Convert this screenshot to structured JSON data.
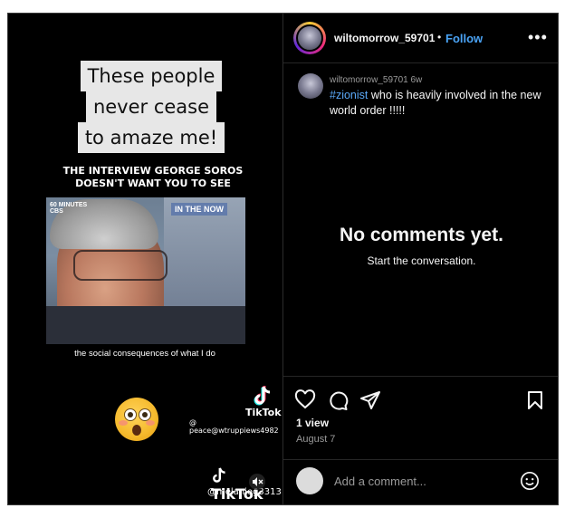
{
  "video": {
    "caption_lines": [
      "These people",
      "never cease",
      "to amaze me!"
    ],
    "subtitle_line1": "THE INTERVIEW GEORGE SOROS",
    "subtitle_line2": "DOESN'T WANT YOU TO SEE",
    "clip_logo_line1": "60 MINUTES",
    "clip_logo_line2": "CBS",
    "clip_badge": "IN THE NOW",
    "clip_subs": "the social consequences of what I do",
    "tiktok_label": "TikTok",
    "tiktok_handle_1": "@ peace@wtruppiews4982",
    "tiktok_label_2": "TikTok",
    "tiktok_handle_2": "@melanieg3313"
  },
  "header": {
    "username": "wiltomorrow_59701",
    "follow_label": "Follow",
    "more_icon": "more-horizontal-icon"
  },
  "post": {
    "username": "wiltomorrow_59701 6w",
    "hashtag": "#zionist",
    "text": " who is heavily involved in the new world order !!!!!"
  },
  "comments": {
    "empty_title": "No comments yet.",
    "empty_subtitle": "Start the conversation."
  },
  "stats": {
    "views": "1 view",
    "date": "August 7"
  },
  "comment_box": {
    "placeholder": "Add a comment..."
  },
  "colors": {
    "accent": "#4aa3f5",
    "background": "#000000",
    "text": "#f5f5f5",
    "muted": "#9a9a9a"
  }
}
